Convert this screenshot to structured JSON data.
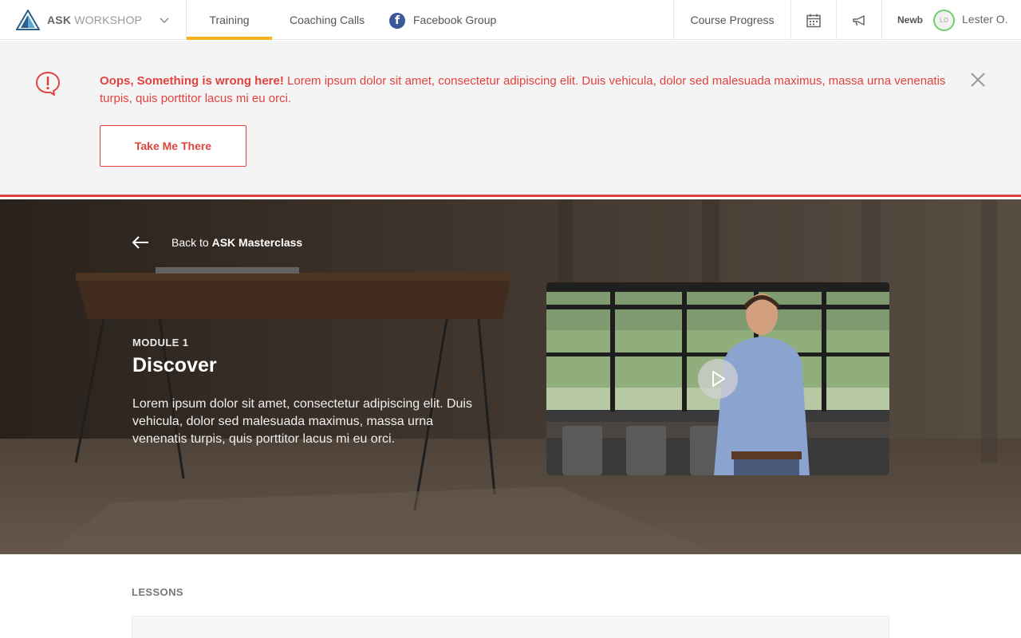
{
  "brand": {
    "name_bold": "ASK",
    "name_light": "WORKSHOP"
  },
  "nav": {
    "training": "Training",
    "coaching": "Coaching Calls",
    "facebook": "Facebook Group",
    "progress": "Course Progress",
    "rank": "Newb",
    "avatar_initials": "LO",
    "user_name": "Lester O."
  },
  "alert": {
    "title": "Oops, Something is wrong here!",
    "message": "Lorem ipsum dolor sit amet, consectetur adipiscing elit. Duis vehicula, dolor sed malesuada maximus, massa urna venenatis turpis, quis porttitor lacus mi eu orci.",
    "button": "Take Me There"
  },
  "hero": {
    "back_prefix": "Back to",
    "back_target": "ASK Masterclass",
    "module_label": "MODULE 1",
    "module_title": "Discover",
    "module_desc": "Lorem ipsum dolor sit amet, consectetur adipiscing elit. Duis vehicula, dolor sed malesuada maximus, massa urna venenatis turpis, quis porttitor lacus mi eu orci."
  },
  "lessons": {
    "heading": "LESSONS"
  },
  "colors": {
    "accent_yellow": "#f6b21b",
    "error_red": "#e0433f",
    "facebook_blue": "#3b5998",
    "avatar_ring": "#6ccf6c"
  },
  "icons": [
    "logo-triangle-icon",
    "chevron-down-icon",
    "facebook-icon",
    "calendar-icon",
    "megaphone-icon",
    "alert-bubble-icon",
    "close-icon",
    "arrow-left-icon",
    "play-icon"
  ]
}
